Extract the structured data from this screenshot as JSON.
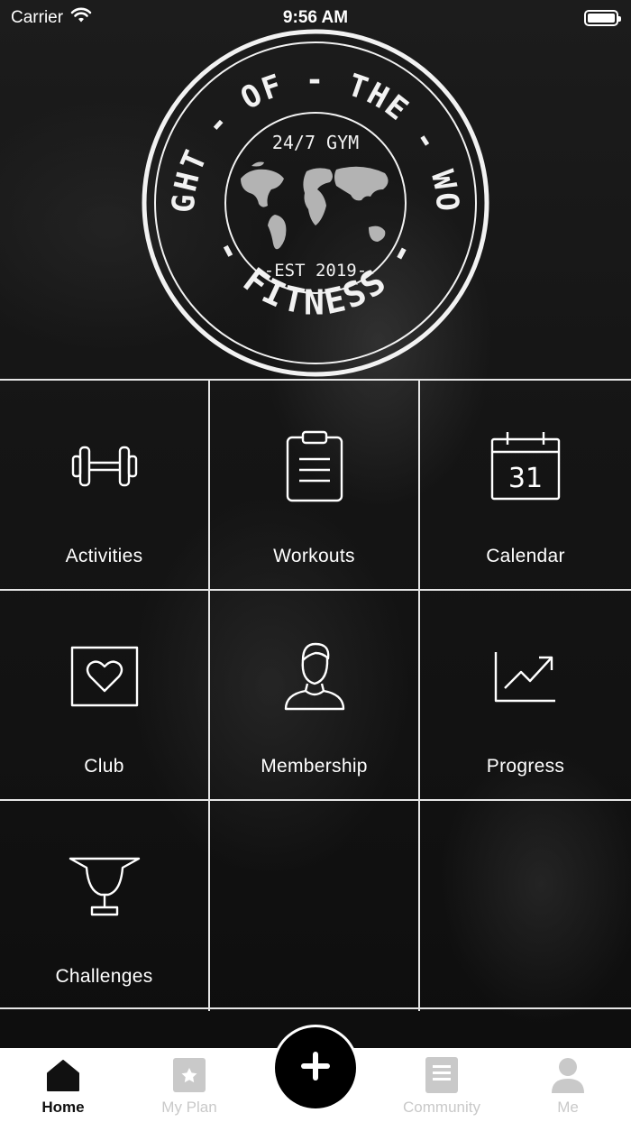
{
  "status_bar": {
    "carrier": "Carrier",
    "time": "9:56 AM"
  },
  "logo": {
    "arc_top": "WEIGHT - OF - THE - WORLD",
    "arc_bottom": "- FITNESS -",
    "inner_top": "24/7 GYM",
    "inner_bottom": "-EST 2019-"
  },
  "grid": {
    "items": [
      {
        "label": "Activities",
        "icon": "dumbbell-icon"
      },
      {
        "label": "Workouts",
        "icon": "clipboard-icon"
      },
      {
        "label": "Calendar",
        "icon": "calendar-icon",
        "icon_text": "31"
      },
      {
        "label": "Club",
        "icon": "heart-icon"
      },
      {
        "label": "Membership",
        "icon": "user-icon"
      },
      {
        "label": "Progress",
        "icon": "trend-chart-icon"
      },
      {
        "label": "Challenges",
        "icon": "trophy-icon"
      }
    ]
  },
  "tab_bar": {
    "home": "Home",
    "my_plan": "My Plan",
    "community": "Community",
    "me": "Me",
    "active": "Home"
  },
  "colors": {
    "accent": "#000000",
    "inactive_tab": "#c9c9c9",
    "grid_line": "#e6e6e6"
  }
}
